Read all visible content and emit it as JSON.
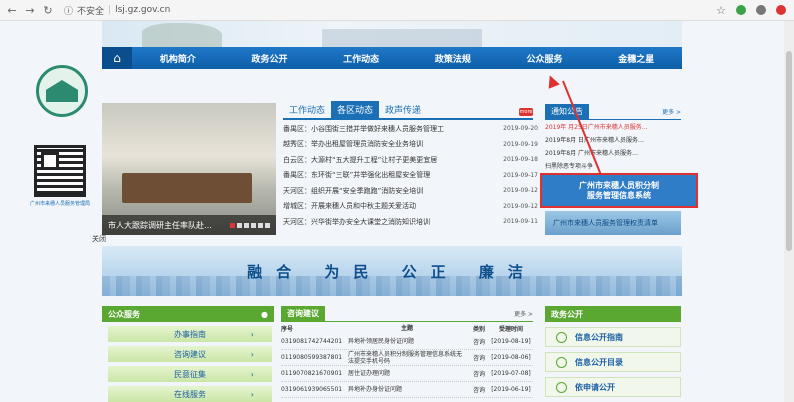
{
  "browser": {
    "insecure_label": "不安全",
    "url": "lsj.gz.gov.cn"
  },
  "nav": {
    "items": [
      "机构简介",
      "政务公开",
      "工作动态",
      "政策法规",
      "公众服务",
      "金穗之星"
    ]
  },
  "qr_caption": "广州市来穗人员服务管理局",
  "photo": {
    "caption": "市人大跟踪调研主任率队赴…"
  },
  "close_label": "关闭",
  "news": {
    "tabs": [
      "工作动态",
      "各区动态",
      "政声传递"
    ],
    "more": "more",
    "items": [
      {
        "title": "番禺区：小谷围街三措并举做好来穗人员服务管理工",
        "date": "2019-09-20"
      },
      {
        "title": "越秀区：举办出租屋管理员消防安全业务培训",
        "date": "2019-09-19"
      },
      {
        "title": "白云区：大源村“五大提升工程”让村子更美更宜居",
        "date": "2019-09-18"
      },
      {
        "title": "番禺区：东环街“三联”并举强化出租屋安全管理",
        "date": "2019-09-17"
      },
      {
        "title": "天河区：组织开展“安全季跑跑”消防安全培训",
        "date": "2019-09-12"
      },
      {
        "title": "增城区：开展来穗人员和中秋主题关爱活动",
        "date": "2019-09-12"
      },
      {
        "title": "天河区：兴华街举办安全大课堂之消防知识培训",
        "date": "2019-09-11"
      }
    ]
  },
  "notice": {
    "title": "通知公告",
    "more": "更多 >",
    "items": [
      "2019年 月25日广州市来穗人员服务…",
      "2019年8月 日广州市来穗人员服务…",
      "2019年8月 广州市来穗人员服务…",
      "扫黑除恶专项斗争"
    ]
  },
  "ad": {
    "line1": "广州市来穗人员积分制",
    "line2": "服务管理信息系统",
    "sub": "广州市来穗人员服务管理权责清单"
  },
  "slogan": "融合 为民 公正 廉洁",
  "services": {
    "title": "公众服务",
    "items": [
      "办事指南",
      "咨询建议",
      "民意征集",
      "在线服务"
    ]
  },
  "qa": {
    "title": "咨询建议",
    "more": "更多 >",
    "headers": [
      "序号",
      "主题",
      "类别",
      "受理时间"
    ],
    "rows": [
      [
        "0319081742744201",
        "异地补领居民身份证问题",
        "咨询",
        "[2019-08-19]"
      ],
      [
        "0119080599387801",
        "广州市来穗人员积分制服务管理信息系统无法提交手机号码",
        "咨询",
        "[2019-08-06]"
      ],
      [
        "0119070821670901",
        "居住证办理问题",
        "咨询",
        "[2019-07-08]"
      ],
      [
        "0319061939065501",
        "异地补办身份证问题",
        "咨询",
        "[2019-06-19]"
      ]
    ]
  },
  "open": {
    "title": "政务公开",
    "items": [
      "信息公开指南",
      "信息公开目录",
      "依申请公开"
    ]
  }
}
